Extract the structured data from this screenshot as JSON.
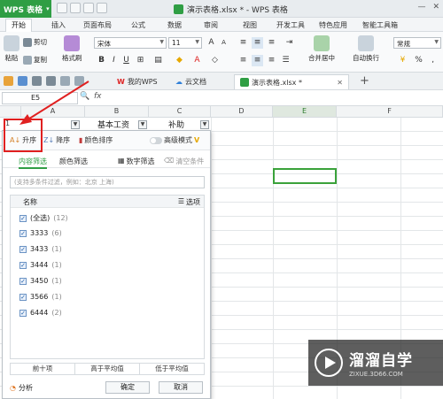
{
  "app": {
    "button_label": "WPS 表格",
    "doc_title": "演示表格.xlsx * - WPS 表格"
  },
  "ribbon_tabs": [
    "开始",
    "插入",
    "页面布局",
    "公式",
    "数据",
    "审阅",
    "视图",
    "开发工具",
    "特色应用",
    "智能工具箱"
  ],
  "ribbon": {
    "paste": "粘贴",
    "cut": "剪切",
    "copy": "复制",
    "format_painter": "格式刷",
    "font_name": "宋体",
    "font_size": "11",
    "bold": "B",
    "italic": "I",
    "underline": "U",
    "font_color": "A",
    "merge_center": "合并居中",
    "wrap_text": "自动换行",
    "number_format": "常规",
    "percent": "%"
  },
  "doc_tabs": {
    "mywps": "我的WPS",
    "cloud": "云文档",
    "active": "演示表格.xlsx *",
    "add": "+"
  },
  "formula_bar": {
    "cell_ref": "E5",
    "fx": "fx"
  },
  "columns": [
    "A",
    "B",
    "C",
    "D",
    "E",
    "F"
  ],
  "cells": {
    "a1": "1",
    "b1": "基本工资",
    "c1": "补助"
  },
  "filter_panel": {
    "sort_asc": "升序",
    "sort_desc": "降序",
    "sort_color": "颜色排序",
    "advanced": "高级模式",
    "tab_content": "内容筛选",
    "tab_color": "颜色筛选",
    "number_filter": "数字筛选",
    "clear": "清空条件",
    "search_placeholder": "(支持多条件过滤，例如：北京 上海)",
    "list_header": "名称",
    "options": "选项",
    "items": [
      {
        "label": "(全选)",
        "count": "(12)"
      },
      {
        "label": "3333",
        "count": "(6)"
      },
      {
        "label": "3433",
        "count": "(1)"
      },
      {
        "label": "3444",
        "count": "(1)"
      },
      {
        "label": "3450",
        "count": "(1)"
      },
      {
        "label": "3566",
        "count": "(1)"
      },
      {
        "label": "6444",
        "count": "(2)"
      }
    ],
    "top10": "前十项",
    "above_avg": "高于平均值",
    "below_avg": "低于平均值",
    "analysis": "分析",
    "ok": "确定",
    "cancel": "取消"
  },
  "watermark": {
    "brand": "溜溜自学",
    "url": "ZIXUE.3D66.COM"
  },
  "colors": {
    "accent_green": "#2f9e44",
    "annotation_red": "#e02020"
  }
}
